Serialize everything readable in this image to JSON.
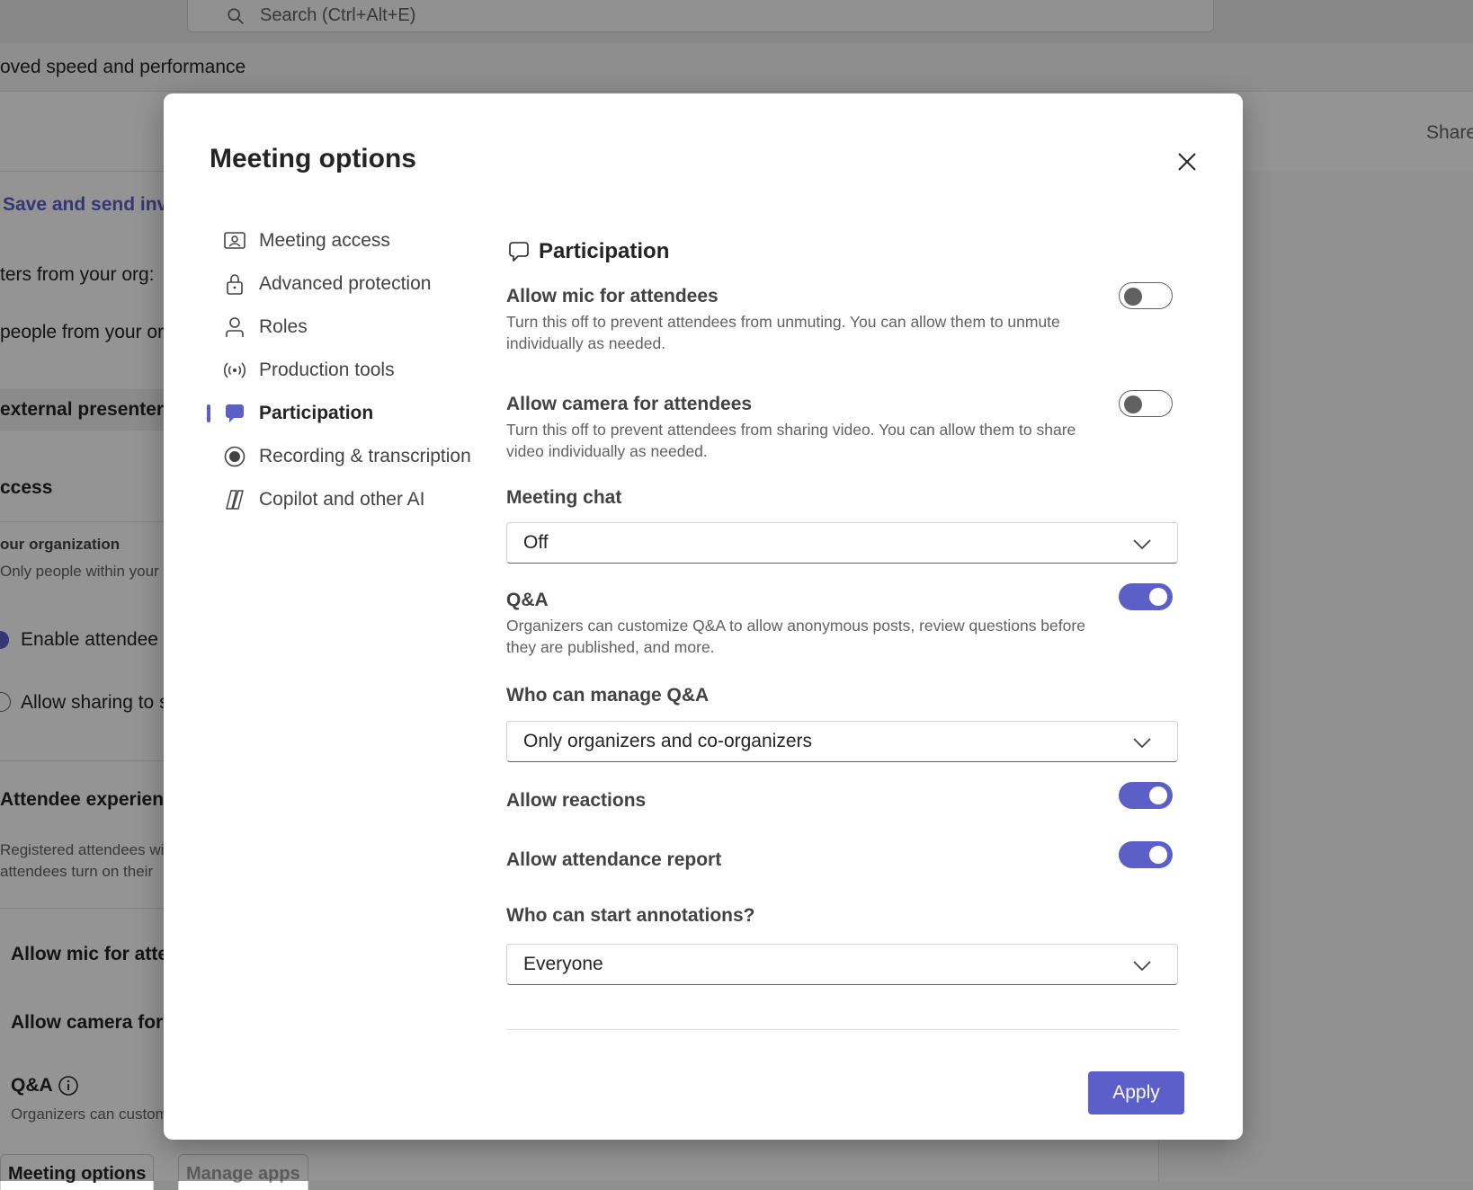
{
  "background": {
    "search_placeholder": "Search (Ctrl+Alt+E)",
    "banner_text": "oved speed and performance",
    "share_label": "Share",
    "save_send_label": "Save and send invit",
    "lines": [
      "ters from your org:",
      "people from your or",
      "external presenters",
      "ccess",
      "our organization",
      "Only people within your",
      "Enable attendee e",
      "Allow sharing to s",
      "Attendee experience",
      "Registered attendees wi",
      "attendees turn on their",
      "Allow mic for atte",
      "Allow camera for a",
      "Q&A",
      "Organizers can custom"
    ],
    "bottom_tabs": [
      "Meeting options",
      "Manage apps"
    ]
  },
  "dialog": {
    "title": "Meeting options",
    "close_label": "Close",
    "nav": [
      {
        "label": "Meeting access",
        "icon": "meeting-access-icon"
      },
      {
        "label": "Advanced protection",
        "icon": "lock-icon"
      },
      {
        "label": "Roles",
        "icon": "person-icon"
      },
      {
        "label": "Production tools",
        "icon": "broadcast-icon"
      },
      {
        "label": "Participation",
        "icon": "chat-bubble-icon",
        "active": true
      },
      {
        "label": "Recording & transcription",
        "icon": "record-icon"
      },
      {
        "label": "Copilot and other AI",
        "icon": "copilot-icon"
      }
    ],
    "section_title": "Participation",
    "settings": {
      "mic": {
        "title": "Allow mic for attendees",
        "desc": "Turn this off to prevent attendees from unmuting. You can allow them to unmute individually as needed.",
        "enabled": false
      },
      "camera": {
        "title": "Allow camera for attendees",
        "desc": "Turn this off to prevent attendees from sharing video. You can allow them to share video individually as needed.",
        "enabled": false
      },
      "meeting_chat": {
        "label": "Meeting chat",
        "value": "Off"
      },
      "qa": {
        "title": "Q&A",
        "desc": "Organizers can customize Q&A to allow anonymous posts, review questions before they are published, and more.",
        "enabled": true
      },
      "manage_qa": {
        "label": "Who can manage Q&A",
        "value": "Only organizers and co-organizers"
      },
      "reactions": {
        "title": "Allow reactions",
        "enabled": true
      },
      "attendance": {
        "title": "Allow attendance report",
        "enabled": true
      },
      "annotations": {
        "label": "Who can start annotations?",
        "value": "Everyone"
      }
    },
    "apply_label": "Apply"
  },
  "colors": {
    "accent": "#5b5fc7",
    "toggle_off": "#616161",
    "text": "#242424"
  }
}
